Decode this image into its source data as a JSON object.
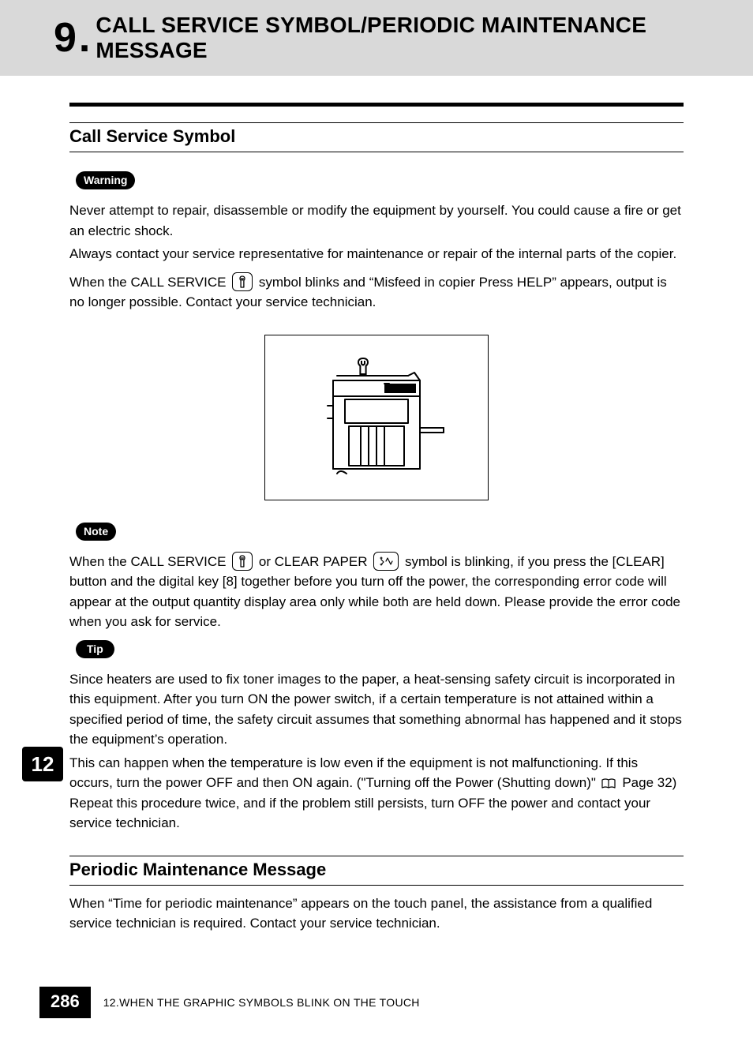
{
  "chapter": {
    "number": "9",
    "dot": ".",
    "title": "CALL SERVICE SYMBOL/PERIODIC MAINTENANCE MESSAGE"
  },
  "section1": {
    "title": "Call Service Symbol",
    "warning_label": "Warning",
    "warning_p1": "Never attempt to repair, disassemble or modify the equipment by yourself. You could cause a fire or get an electric shock.",
    "warning_p2": "Always contact your service representative for maintenance or repair of the internal parts of the copier.",
    "p3_a": "When the CALL SERVICE ",
    "p3_b": " symbol blinks and “Misfeed in copier Press HELP” appears, output is no longer possible. Contact your service technician.",
    "note_label": "Note",
    "note_a": "When the CALL SERVICE ",
    "note_b": " or CLEAR PAPER ",
    "note_c": " symbol is blinking, if you press the [CLEAR] button and the digital key [8] together before you turn off the power, the corresponding error code will appear at the output quantity display area only while both are held down. Please provide the error code when you ask for service.",
    "tip_label": "Tip",
    "tip_p1": "Since heaters are used to fix toner images to the paper, a heat-sensing safety circuit is incorporated in this equipment. After you turn ON the power switch, if a certain temperature is not attained within a specified period of time, the safety circuit assumes that something abnormal has happened and it stops the equipment’s operation.",
    "tip_p2_a": "This can happen when the temperature is low even if the equipment is not malfunctioning. If this occurs, turn the power OFF and then ON again. (\"Turning off the Power (Shutting down)\" ",
    "tip_p2_b": " Page 32) Repeat this procedure twice, and if the problem still persists, turn OFF the power and contact your service technician."
  },
  "section2": {
    "title": "Periodic Maintenance Message",
    "p1": "When “Time for periodic maintenance” appears on the touch panel, the assistance from a qualified service technician is required. Contact your service technician."
  },
  "tab_number": "12",
  "footer": {
    "page": "286",
    "text": "12.WHEN THE GRAPHIC SYMBOLS BLINK ON THE TOUCH"
  }
}
